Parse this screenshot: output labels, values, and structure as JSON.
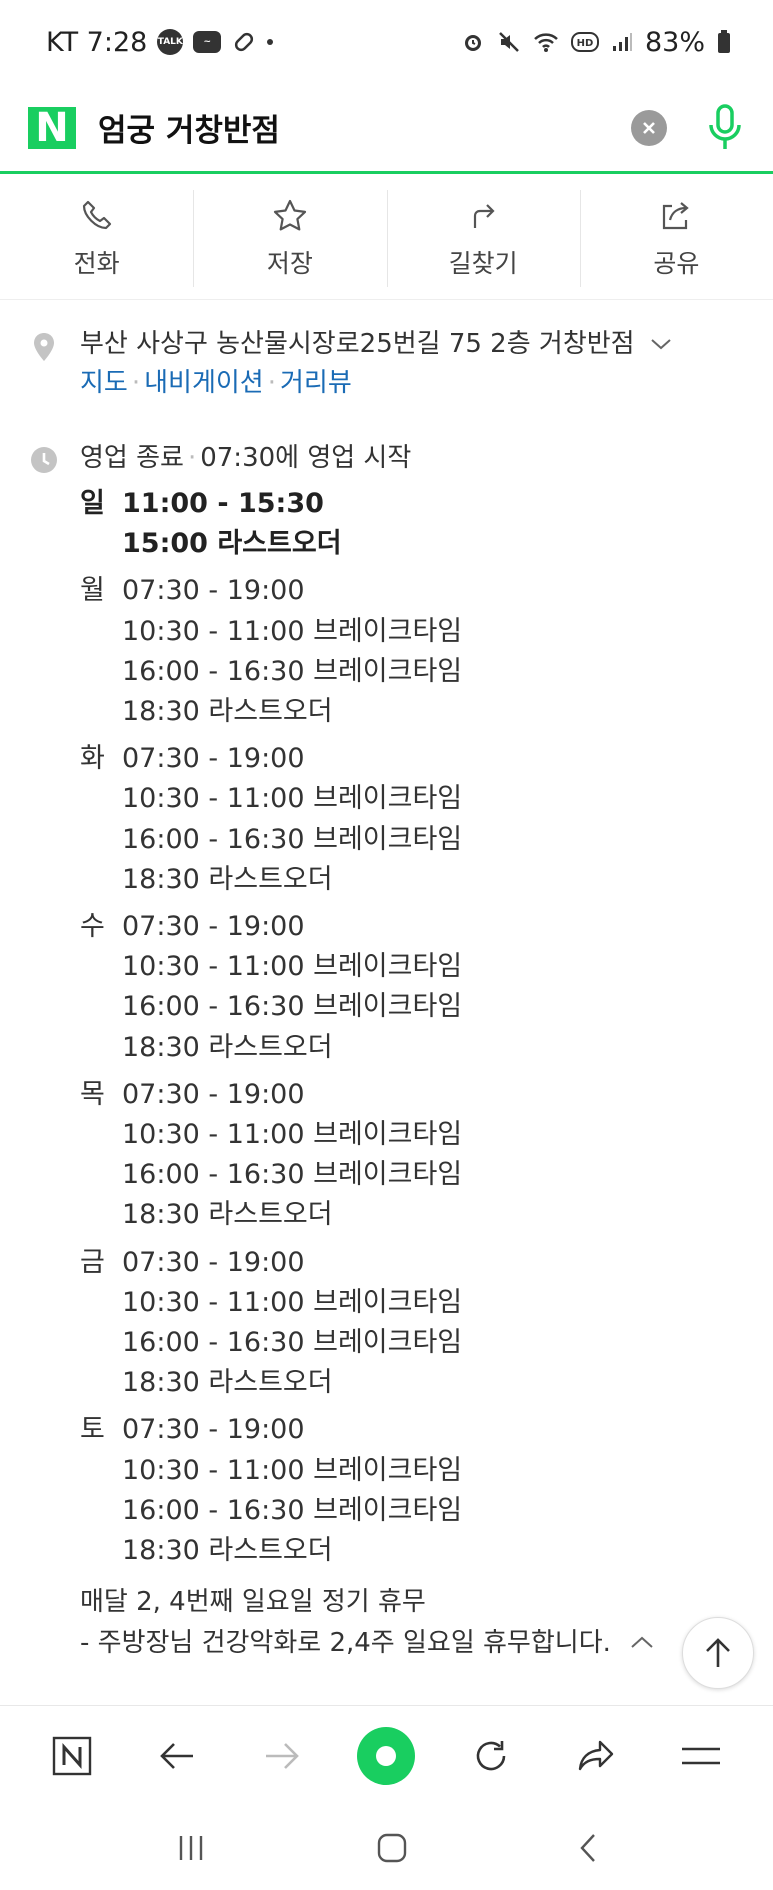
{
  "status_bar": {
    "carrier_time": "KT 7:28",
    "battery": "83%"
  },
  "search": {
    "query": "엄궁 거창반점",
    "logo": "N"
  },
  "actions": [
    {
      "label": "전화",
      "icon": "phone-icon"
    },
    {
      "label": "저장",
      "icon": "star-icon"
    },
    {
      "label": "길찾기",
      "icon": "directions-icon"
    },
    {
      "label": "공유",
      "icon": "share-icon"
    }
  ],
  "address": {
    "text": "부산 사상구 농산물시장로25번길 75 2층 거창반점",
    "links": [
      "지도",
      "내비게이션",
      "거리뷰"
    ]
  },
  "hours": {
    "status": "영업 종료",
    "next": "07:30에 영업 시작",
    "days": [
      {
        "day": "일",
        "lines": [
          "11:00 - 15:30",
          "15:00 라스트오더"
        ]
      },
      {
        "day": "월",
        "lines": [
          "07:30 - 19:00",
          "10:30 - 11:00 브레이크타임",
          "16:00 - 16:30 브레이크타임",
          "18:30 라스트오더"
        ]
      },
      {
        "day": "화",
        "lines": [
          "07:30 - 19:00",
          "10:30 - 11:00 브레이크타임",
          "16:00 - 16:30 브레이크타임",
          "18:30 라스트오더"
        ]
      },
      {
        "day": "수",
        "lines": [
          "07:30 - 19:00",
          "10:30 - 11:00 브레이크타임",
          "16:00 - 16:30 브레이크타임",
          "18:30 라스트오더"
        ]
      },
      {
        "day": "목",
        "lines": [
          "07:30 - 19:00",
          "10:30 - 11:00 브레이크타임",
          "16:00 - 16:30 브레이크타임",
          "18:30 라스트오더"
        ]
      },
      {
        "day": "금",
        "lines": [
          "07:30 - 19:00",
          "10:30 - 11:00 브레이크타임",
          "16:00 - 16:30 브레이크타임",
          "18:30 라스트오더"
        ]
      },
      {
        "day": "토",
        "lines": [
          "07:30 - 19:00",
          "10:30 - 11:00 브레이크타임",
          "16:00 - 16:30 브레이크타임",
          "18:30 라스트오더"
        ]
      }
    ],
    "note1": "매달 2, 4번째 일요일 정기 휴무",
    "note2": "- 주방장님 건강악화로 2,4주 일요일 휴무합니다."
  },
  "colors": {
    "brand": "#19ce60",
    "link": "#1a6bb5"
  }
}
